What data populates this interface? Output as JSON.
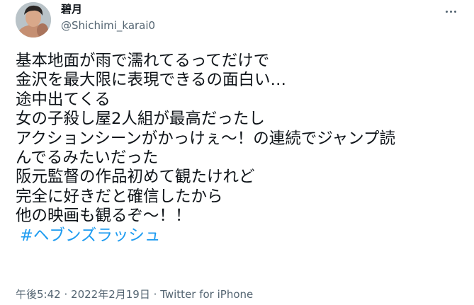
{
  "author": {
    "display_name": "碧月",
    "handle": "@Shichimi_karai0",
    "avatar_icon": "profile-photo-icon"
  },
  "more_icon": "more-options-icon",
  "tweet": {
    "lines": [
      "基本地面が雨で濡れてるってだけで",
      "金沢を最大限に表現できるの面白い…",
      "途中出てくる",
      "女の子殺し屋2人組が最高だったし",
      "アクションシーンがかっけぇ〜！の連続でジャンプ読",
      "んでるみたいだった",
      "阪元監督の作品初めて観たけれど",
      "完全に好きだと確信したから",
      "他の映画も観るぞ〜！！"
    ],
    "hashtag": "#ヘブンズラッシュ"
  },
  "meta": {
    "time": "午後5:42",
    "separator": "·",
    "date": "2022年2月19日",
    "source": "Twitter for iPhone"
  },
  "colors": {
    "text": "#0f1419",
    "secondary": "#536471",
    "link": "#1d9bf0"
  }
}
